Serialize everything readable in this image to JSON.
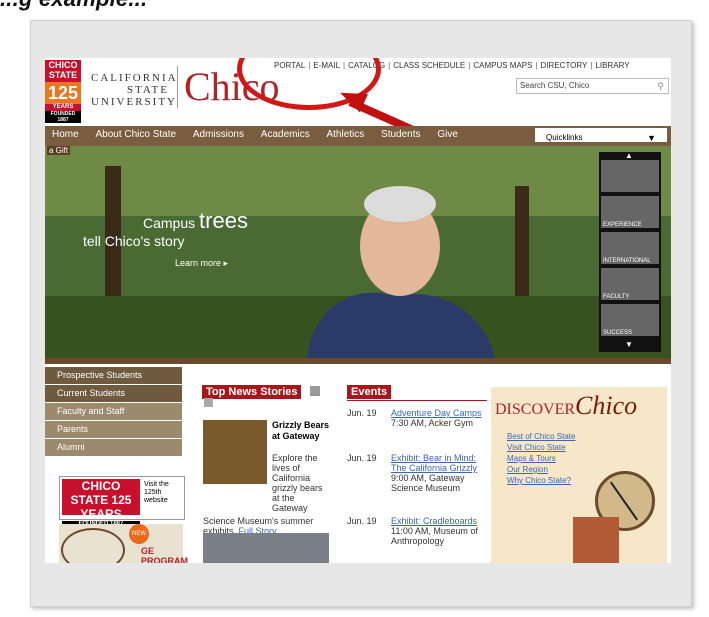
{
  "caption": "...g example...",
  "header": {
    "logo_badge": "CHICO STATE",
    "logo_number": "125",
    "logo_years": "YEARS",
    "logo_founded": "FOUNDED 1887",
    "csu_line1": "CALIFORNIA",
    "csu_line2": "STATE",
    "csu_line3": "UNIVERSITY",
    "wordmark": "Chico",
    "topnav": [
      "PORTAL",
      "E-MAIL",
      "CATALOG",
      "CLASS SCHEDULE",
      "CAMPUS MAPS",
      "DIRECTORY",
      "LIBRARY"
    ],
    "search_placeholder": "Search CSU, Chico"
  },
  "mainnav": {
    "items": [
      "Home",
      "About Chico State",
      "Admissions",
      "Academics",
      "Athletics",
      "Students",
      "Give"
    ],
    "gift_text": "a Gift",
    "quicklinks_label": "Quicklinks"
  },
  "hero": {
    "line1_small": "Campus",
    "line1_big": "trees",
    "line2": "tell Chico's story",
    "learn_more": "Learn more ▸",
    "thumbs": [
      "",
      "EXPERIENCE",
      "INTERNATIONAL",
      "FACULTY",
      "SUCCESS"
    ]
  },
  "leftnav": {
    "items": [
      "Prospective Students",
      "Current Students",
      "Faculty and Staff",
      "Parents",
      "Alumni"
    ]
  },
  "promo125": {
    "badge": "CHICO STATE 125 YEARS",
    "founded": "FOUNDED 1887",
    "cta": "Visit the 125th website"
  },
  "ge": {
    "new_label": "NEW",
    "label": "GE PROGRAM"
  },
  "news": {
    "heading": "Top News Stories",
    "title": "Grizzly Bears at Gateway",
    "body": "Explore the lives of California grizzly bears at the Gateway",
    "body2": "Science Museum's summer exhibits.",
    "link": "Full Story"
  },
  "events": {
    "heading": "Events",
    "items": [
      {
        "date": "Jun. 19",
        "title": "Adventure Day Camps",
        "detail": "7:30 AM, Acker Gym"
      },
      {
        "date": "Jun. 19",
        "title": "Exhibit: Bear in Mind: The California Grizzly",
        "detail": "9:00 AM, Gateway Science Museum"
      },
      {
        "date": "Jun. 19",
        "title": "Exhibit: Cradleboards",
        "detail": "11:00 AM, Museum of Anthropology"
      }
    ]
  },
  "discover": {
    "title": "DISCOVER",
    "title_script": "Chico",
    "links": [
      "Best of Chico State",
      "Visit Chico State",
      "Maps & Tours",
      "Our Region",
      "Why Chico State?"
    ]
  }
}
